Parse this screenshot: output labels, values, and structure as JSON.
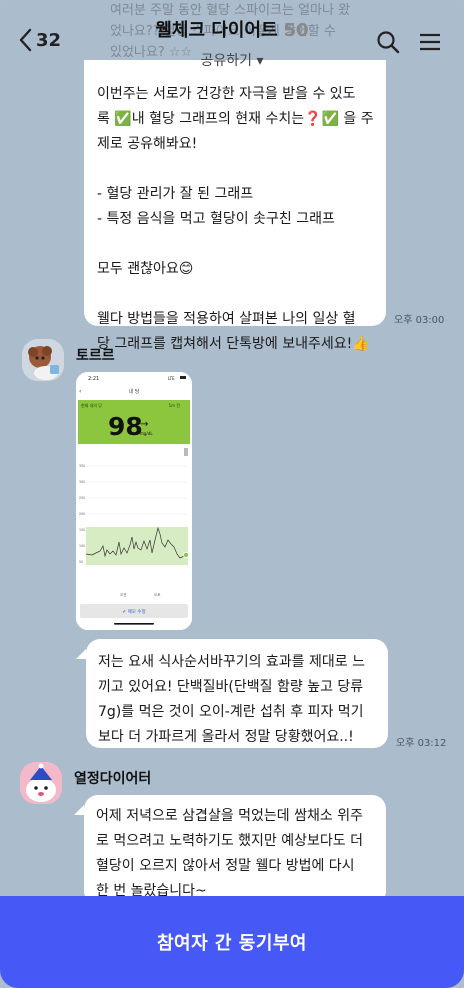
{
  "header": {
    "back_count": "32",
    "title": "웰체크 다이어트",
    "member_count": "50",
    "share_label": "공유하기 ▾",
    "ghost_lines": [
      "여러분 주말 동안 혈당 스파이크는 얼마나 왔",
      "었나요?? 혈당 스파이크 어떻게 방어할 수",
      "있었나요? ☆☆"
    ]
  },
  "messages": [
    {
      "lines": [
        "이번주는 서로가 건강한 자극을 받을 수 있도",
        "록 ✅내 혈당 그래프의 현재 수치는❓✅ 을 주",
        "제로 공유해봐요!",
        "",
        "- 혈당 관리가 잘 된 그래프",
        "- 특정 음식을 먹고 혈당이 솟구친 그래프",
        "",
        "모두 괜찮아요😊",
        "",
        "웰다 방법들을 적용하여 살펴본 나의 일상 혈",
        "당 그래프를 캡쳐해서 단톡방에 보내주세요!👍"
      ],
      "time": "오후 03:00"
    },
    {
      "sender": "토르르",
      "screenshot": {
        "status_time": "2:21",
        "status_right": "LTE",
        "nav_title": "내 당",
        "range_label": "현재 내의 당",
        "range_right": "1m 전",
        "glucose_value": "98",
        "glucose_unit": "mg/dL",
        "y_ticks": [
          "350",
          "300",
          "250",
          "200",
          "150",
          "100",
          "50"
        ],
        "x_ticks": [
          "오전",
          "오후"
        ],
        "edit_button": "✔ 메모 수정"
      },
      "lines": [
        "저는 요새 식사순서바꾸기의 효과를 제대로 느",
        "끼고 있어요! 단백질바(단백질 함량 높고 당류",
        "7g)를 먹은 것이 오이-계란 섭취 후 피자 먹기",
        "보다 더 가파르게 올라서 정말 당황했어요..!"
      ],
      "time": "오후 03:12"
    },
    {
      "sender": "열정다이어터",
      "lines": [
        "어제 저녁으로 삼겹살을 먹었는데 쌈채소 위주",
        "로 먹으려고 노력하기도 했지만 예상보다도 더",
        "혈당이 오르지 않아서 정말 웰다 방법에 다시",
        "한 번 놀랐습니다~"
      ]
    }
  ],
  "bottom_button": "참여자 간 동기부여",
  "colors": {
    "background": "#abbccd",
    "bubble": "#ffffff",
    "accent": "#4658f5",
    "chart_green": "#8cc63f"
  }
}
